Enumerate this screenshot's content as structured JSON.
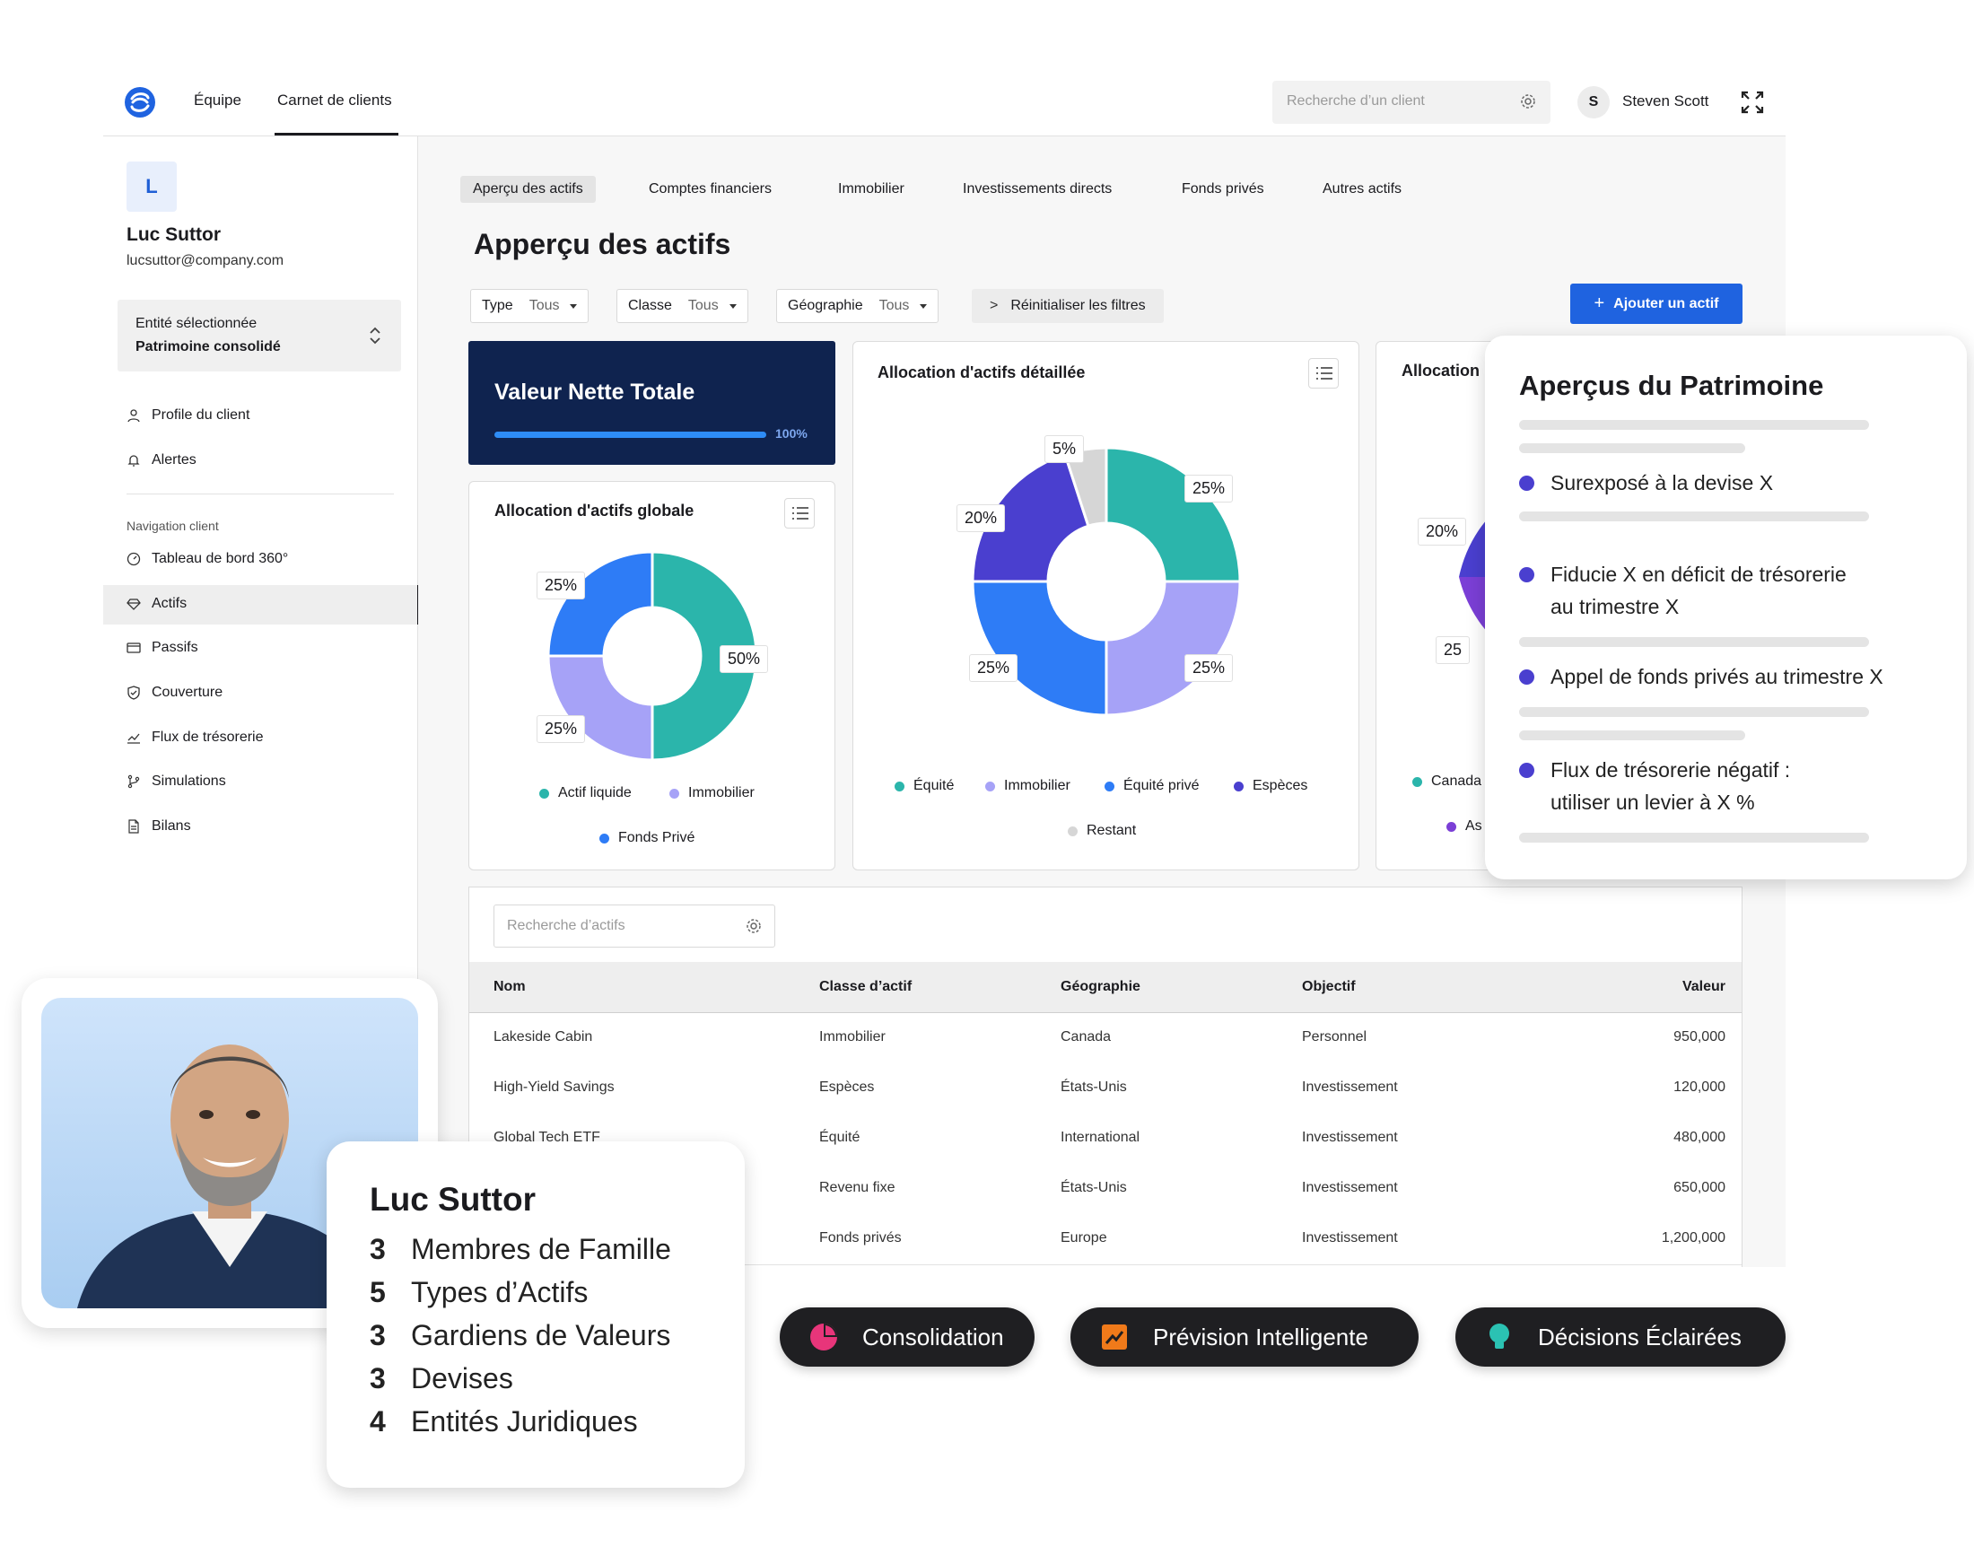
{
  "topbar": {
    "nav": [
      "Équipe",
      "Carnet de clients"
    ],
    "search_placeholder": "Recherche d’un client",
    "user_initial": "S",
    "user_name": "Steven Scott"
  },
  "sidebar": {
    "client_initial": "L",
    "client_name": "Luc Suttor",
    "client_email": "lucsuttor@company.com",
    "entity_label": "Entité sélectionnée",
    "entity_value": "Patrimoine consolidé",
    "items_top": [
      {
        "label": "Profile du client",
        "icon": "user-icon"
      },
      {
        "label": "Alertes",
        "icon": "bell-icon"
      }
    ],
    "nav_title": "Navigation client",
    "items_nav": [
      {
        "label": "Tableau de bord 360°",
        "icon": "dashboard-icon"
      },
      {
        "label": "Actifs",
        "icon": "diamond-icon",
        "active": true
      },
      {
        "label": "Passifs",
        "icon": "card-icon"
      },
      {
        "label": "Couverture",
        "icon": "shield-icon"
      },
      {
        "label": "Flux de trésorerie",
        "icon": "chart-line-icon"
      },
      {
        "label": "Simulations",
        "icon": "branch-icon"
      },
      {
        "label": "Bilans",
        "icon": "document-icon"
      }
    ]
  },
  "main": {
    "tabs": [
      "Aperçu des actifs",
      "Comptes financiers",
      "Immobilier",
      "Investissements directs",
      "Fonds privés",
      "Autres actifs"
    ],
    "title": "Apperçu des actifs",
    "filters": [
      {
        "key": "Type",
        "value": "Tous"
      },
      {
        "key": "Classe",
        "value": "Tous"
      },
      {
        "key": "Géographie",
        "value": "Tous"
      }
    ],
    "reset_label": "Réinitialiser les filtres",
    "add_label": "Ajouter un actif",
    "net_worth": {
      "title": "Valeur Nette Totale",
      "percent_label": "100%",
      "progress": 1.0
    }
  },
  "colors": {
    "teal": "#2bb5ab",
    "lavender": "#a6a2f7",
    "blue": "#2e7cf6",
    "indigo": "#4a3fcf",
    "grey": "#d6d6d6",
    "navy": "#0f234f",
    "accent": "#1f63e0"
  },
  "chart_data": [
    {
      "type": "pie",
      "title": "Allocation d'actifs globale",
      "labels": [
        "Actif liquide",
        "Immobilier",
        "Fonds Privé"
      ],
      "values": [
        50,
        25,
        25
      ],
      "colors": [
        "#2bb5ab",
        "#a6a2f7",
        "#2e7cf6"
      ],
      "legend": "bottom"
    },
    {
      "type": "pie",
      "title": "Allocation d'actifs détaillée",
      "labels": [
        "Équité",
        "Immobilier",
        "Équité privé",
        "Espèces",
        "Restant"
      ],
      "values": [
        25,
        25,
        25,
        20,
        5
      ],
      "colors": [
        "#2bb5ab",
        "#a6a2f7",
        "#2e7cf6",
        "#4a3fcf",
        "#d6d6d6"
      ],
      "legend": "bottom"
    },
    {
      "type": "pie",
      "title": "Allocation",
      "labels": [
        "Canada",
        "As"
      ],
      "visible_slice_labels": [
        "20%",
        "25"
      ],
      "legend": "bottom"
    }
  ],
  "table": {
    "search_placeholder": "Recherche d’actifs",
    "columns": [
      "Nom",
      "Classe d’actif",
      "Géographie",
      "Objectif",
      "Valeur"
    ],
    "rows": [
      [
        "Lakeside Cabin",
        "Immobilier",
        "Canada",
        "Personnel",
        "950,000"
      ],
      [
        "High-Yield Savings",
        "Espèces",
        "États-Unis",
        "Investissement",
        "120,000"
      ],
      [
        "Global Tech ETF",
        "Équité",
        "International",
        "Investissement",
        "480,000"
      ],
      [
        "",
        "Revenu fixe",
        "États-Unis",
        "Investissement",
        "650,000"
      ],
      [
        "",
        "Fonds privés",
        "Europe",
        "Investissement",
        "1,200,000"
      ]
    ]
  },
  "insights": {
    "title": "Aperçus du Patrimoine",
    "items": [
      [
        "Surexposé à la devise X"
      ],
      [
        "Fiducie X en déficit de trésorerie",
        "au trimestre X"
      ],
      [
        "Appel de fonds privés au trimestre X"
      ],
      [
        "Flux de trésorerie négatif :",
        "utiliser un levier à X %"
      ]
    ]
  },
  "profile": {
    "name": "Luc Suttor",
    "stats": [
      {
        "n": "3",
        "label": "Membres de Famille"
      },
      {
        "n": "5",
        "label": "Types d’Actifs"
      },
      {
        "n": "3",
        "label": "Gardiens de Valeurs"
      },
      {
        "n": "3",
        "label": "Devises"
      },
      {
        "n": "4",
        "label": "Entités Juridiques"
      }
    ]
  },
  "pills": [
    {
      "label": "Consolidation",
      "icon": "pie-icon",
      "color": "#e8357a"
    },
    {
      "label": "Prévision Intelligente",
      "icon": "trend-icon",
      "color": "#f07a1a"
    },
    {
      "label": "Décisions Éclairées",
      "icon": "lightbulb-icon",
      "color": "#2bc2b3"
    }
  ]
}
